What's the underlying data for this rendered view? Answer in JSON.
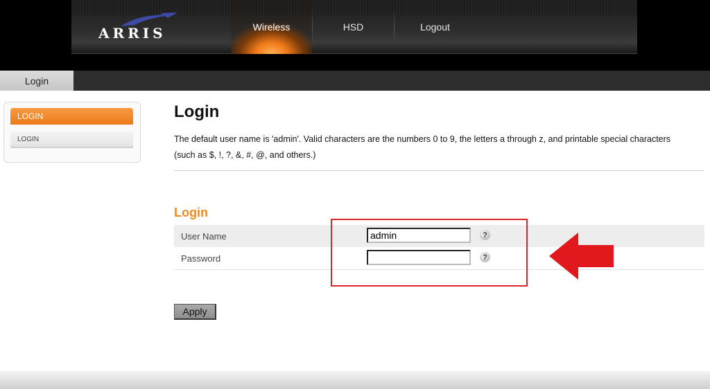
{
  "brand": {
    "name": "ARRIS"
  },
  "nav": {
    "items": [
      {
        "label": "Wireless",
        "active": true
      },
      {
        "label": "HSD",
        "active": false
      },
      {
        "label": "Logout",
        "active": false
      }
    ]
  },
  "subnav": {
    "tab_label": "Login"
  },
  "sidebar": {
    "header_label": "LOGIN",
    "items": [
      {
        "label": "LOGIN"
      }
    ]
  },
  "main": {
    "title": "Login",
    "description_line1": "The default user name is 'admin'. Valid characters are the numbers 0 to 9, the letters a through z, and printable special characters",
    "description_line2": "(such as $, !, ?, &, #, @, and others.)",
    "section_title": "Login",
    "form": {
      "username_label": "User Name",
      "username_value": "admin",
      "password_label": "Password",
      "password_value": "",
      "help_glyph": "?"
    },
    "apply_label": "Apply"
  },
  "colors": {
    "accent_orange": "#ee8a23",
    "annotation_red": "#d9262b",
    "header_black": "#000000"
  },
  "icons": [
    "arris-swoosh-icon",
    "help-icon",
    "red-arrow-icon"
  ]
}
